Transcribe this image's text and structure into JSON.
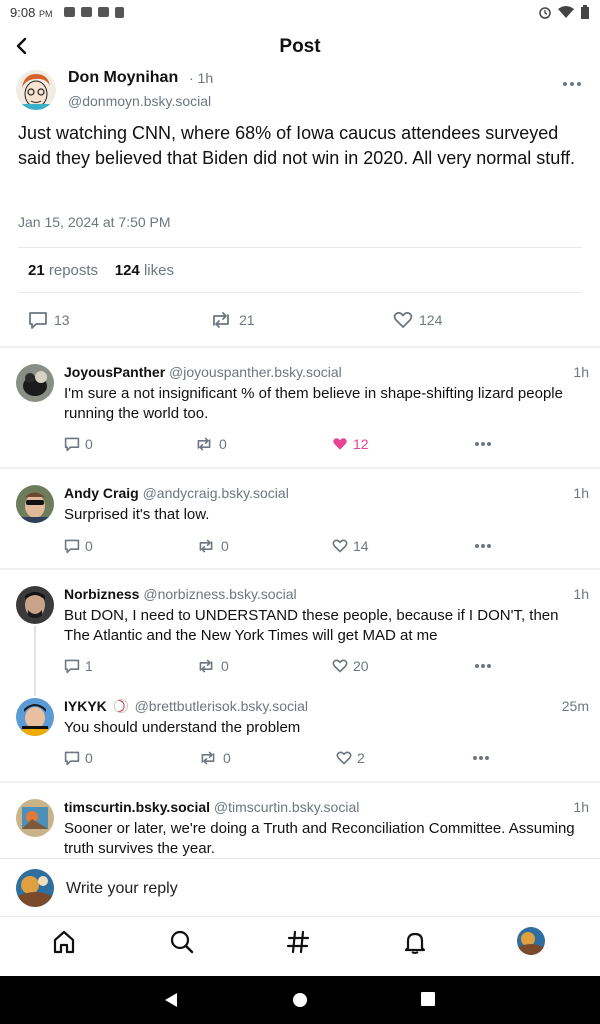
{
  "status_bar": {
    "time": "9:08",
    "ampm": "PM"
  },
  "header": {
    "title": "Post"
  },
  "main_post": {
    "author_name": "Don Moynihan",
    "time": "· 1h",
    "handle": "@donmoyn.bsky.social",
    "text": "Just watching CNN, where 68% of Iowa caucus attendees surveyed said they believed that Biden did not win in 2020. All very normal stuff.",
    "date": "Jan 15, 2024 at 7:50 PM",
    "reposts_count": "21",
    "reposts_label": "reposts",
    "likes_count": "124",
    "likes_label": "likes",
    "actions": {
      "replies": "13",
      "reposts": "21",
      "likes": "124"
    }
  },
  "replies": [
    {
      "name": "JoyousPanther",
      "handle": "@joyouspanther.bsky.social",
      "time": "1h",
      "text": "I'm sure a not insignificant % of them believe in shape-shifting lizard people running the world too.",
      "replies": "0",
      "reposts": "0",
      "likes": "12",
      "liked": true
    },
    {
      "name": "Andy Craig",
      "handle": "@andycraig.bsky.social",
      "time": "1h",
      "text": "Surprised it's that low.",
      "replies": "0",
      "reposts": "0",
      "likes": "14",
      "liked": false
    },
    {
      "name": "Norbizness",
      "handle": "@norbizness.bsky.social",
      "time": "1h",
      "text": "But DON, I need to UNDERSTAND these people, because if I DON'T, then The Atlantic and the New York Times will get MAD at me",
      "replies": "1",
      "reposts": "0",
      "likes": "20",
      "liked": false
    },
    {
      "name": "IYKYK",
      "handle": "@brettbutlerisok.bsky.social",
      "time": "25m",
      "text": "You should understand the problem",
      "replies": "0",
      "reposts": "0",
      "likes": "2",
      "liked": false
    },
    {
      "name": "timscurtin.bsky.social",
      "handle": "@timscurtin.bsky.social",
      "time": "1h",
      "text": "Sooner or later, we're doing a Truth and Reconciliation Committee. Assuming truth survives the year."
    }
  ],
  "composer": {
    "placeholder": "Write your reply"
  },
  "colors": {
    "accent_like": "#e94393",
    "muted": "#6f7680",
    "divider": "#e6e8eb"
  },
  "icons": [
    "back-arrow-icon",
    "more-icon",
    "comment-icon",
    "repost-icon",
    "heart-icon",
    "home-icon",
    "search-icon",
    "hashtag-icon",
    "bell-icon"
  ]
}
